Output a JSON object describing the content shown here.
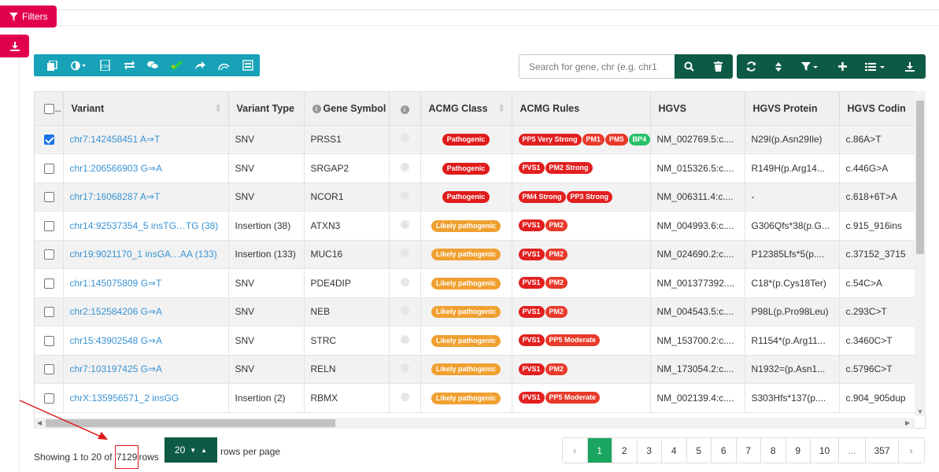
{
  "filters_button": {
    "label": "Filters",
    "icon": "filter-icon"
  },
  "side_download": {
    "icon": "download-icon"
  },
  "left_toolbar": {
    "color": "#17a2b8",
    "icons": [
      "copy-icon",
      "contrast-icon",
      "csv-icon",
      "exchange-icon",
      "comments-icon",
      "check-icon",
      "share-icon",
      "rainbow-icon",
      "export-icon"
    ]
  },
  "search": {
    "placeholder": "Search for gene, chr (e.g. chr1",
    "value": ""
  },
  "right_toolbar": {
    "color": "#0e5b45",
    "icons": [
      "refresh-icon",
      "sort-icon",
      "filter-dropdown-icon",
      "plus-icon",
      "columns-icon",
      "download-icon"
    ]
  },
  "table": {
    "columns": [
      "",
      "Variant",
      "Variant Type",
      "Gene Symbol",
      "",
      "ACMG Class",
      "ACMG Rules",
      "HGVS",
      "HGVS Protein",
      "HGVS Codin"
    ],
    "rows": [
      {
        "checked": true,
        "variant": "chr7:142458451 A⇒T",
        "type": "SNV",
        "gene": "PRSS1",
        "acmg_class": "Pathogenic",
        "rules": [
          {
            "t": "PP5 Very Strong",
            "c": "#e21f1f"
          },
          {
            "t": "PM1",
            "c": "#e8392a"
          },
          {
            "t": "PM5",
            "c": "#e8392a"
          },
          {
            "t": "BP4",
            "c": "#28c06a"
          }
        ],
        "hgvs": "NM_002769.5:c....",
        "protein": "N29I(p.Asn29Ile)",
        "coding": "c.86A>T"
      },
      {
        "checked": false,
        "variant": "chr1:206566903 G⇒A",
        "type": "SNV",
        "gene": "SRGAP2",
        "acmg_class": "Pathogenic",
        "rules": [
          {
            "t": "PVS1",
            "c": "#e21f1f"
          },
          {
            "t": "PM2 Strong",
            "c": "#e21f1f"
          }
        ],
        "hgvs": "NM_015326.5:c....",
        "protein": "R149H(p.Arg14...",
        "coding": "c.446G>A"
      },
      {
        "checked": false,
        "variant": "chr17:16068287 A⇒T",
        "type": "SNV",
        "gene": "NCOR1",
        "acmg_class": "Pathogenic",
        "rules": [
          {
            "t": "PM4 Strong",
            "c": "#e21f1f"
          },
          {
            "t": "PP3 Strong",
            "c": "#e21f1f"
          }
        ],
        "hgvs": "NM_006311.4:c....",
        "protein": "-",
        "coding": "c.618+6T>A"
      },
      {
        "checked": false,
        "variant": "chr14:92537354_5 insTG…TG (38)",
        "type": "Insertion (38)",
        "gene": "ATXN3",
        "acmg_class": "Likely pathogenic",
        "rules": [
          {
            "t": "PVS1",
            "c": "#e21f1f"
          },
          {
            "t": "PM2",
            "c": "#e8392a"
          }
        ],
        "hgvs": "NM_004993.6:c....",
        "protein": "G306Qfs*38(p.G...",
        "coding": "c.915_916ins"
      },
      {
        "checked": false,
        "variant": "chr19:9021170_1 insGA…AA (133)",
        "type": "Insertion (133)",
        "gene": "MUC16",
        "acmg_class": "Likely pathogenic",
        "rules": [
          {
            "t": "PVS1",
            "c": "#e21f1f"
          },
          {
            "t": "PM2",
            "c": "#e8392a"
          }
        ],
        "hgvs": "NM_024690.2:c....",
        "protein": "P12385Lfs*5(p....",
        "coding": "c.37152_3715"
      },
      {
        "checked": false,
        "variant": "chr1:145075809 G⇒T",
        "type": "SNV",
        "gene": "PDE4DIP",
        "acmg_class": "Likely pathogenic",
        "rules": [
          {
            "t": "PVS1",
            "c": "#e21f1f"
          },
          {
            "t": "PM2",
            "c": "#e8392a"
          }
        ],
        "hgvs": "NM_001377392....",
        "protein": "C18*(p.Cys18Ter)",
        "coding": "c.54C>A"
      },
      {
        "checked": false,
        "variant": "chr2:152584206 G⇒A",
        "type": "SNV",
        "gene": "NEB",
        "acmg_class": "Likely pathogenic",
        "rules": [
          {
            "t": "PVS1",
            "c": "#e21f1f"
          },
          {
            "t": "PM2",
            "c": "#e8392a"
          }
        ],
        "hgvs": "NM_004543.5:c....",
        "protein": "P98L(p.Pro98Leu)",
        "coding": "c.293C>T"
      },
      {
        "checked": false,
        "variant": "chr15:43902548 G⇒A",
        "type": "SNV",
        "gene": "STRC",
        "acmg_class": "Likely pathogenic",
        "rules": [
          {
            "t": "PVS1",
            "c": "#e21f1f"
          },
          {
            "t": "PP5 Moderate",
            "c": "#e8392a"
          }
        ],
        "hgvs": "NM_153700.2:c....",
        "protein": "R1154*(p.Arg11...",
        "coding": "c.3460C>T"
      },
      {
        "checked": false,
        "variant": "chr7:103197425 G⇒A",
        "type": "SNV",
        "gene": "RELN",
        "acmg_class": "Likely pathogenic",
        "rules": [
          {
            "t": "PVS1",
            "c": "#e21f1f"
          },
          {
            "t": "PM2",
            "c": "#e8392a"
          }
        ],
        "hgvs": "NM_173054.2:c....",
        "protein": "N1932=(p.Asn1...",
        "coding": "c.5796C>T"
      },
      {
        "checked": false,
        "variant": "chrX:135956571_2 insGG",
        "type": "Insertion (2)",
        "gene": "RBMX",
        "acmg_class": "Likely pathogenic",
        "rules": [
          {
            "t": "PVS1",
            "c": "#e21f1f"
          },
          {
            "t": "PP5 Moderate",
            "c": "#e8392a"
          }
        ],
        "hgvs": "NM_002139.4:c....",
        "protein": "S303Hfs*137(p....",
        "coding": "c.904_905dup"
      }
    ],
    "class_colors": {
      "Pathogenic": "#e01b1b",
      "Likely pathogenic": "#f0a030"
    }
  },
  "pager": {
    "showing_prefix": "Showing 1 to 20 of",
    "total": "7129",
    "rows_label": "rows",
    "page_size": "20",
    "rows_per_page": "rows per page",
    "pages": [
      "‹",
      "1",
      "2",
      "3",
      "4",
      "5",
      "6",
      "7",
      "8",
      "9",
      "10",
      "...",
      "357",
      "›"
    ],
    "active_page": "1"
  },
  "annotation": {
    "color": "#e01b1b"
  }
}
